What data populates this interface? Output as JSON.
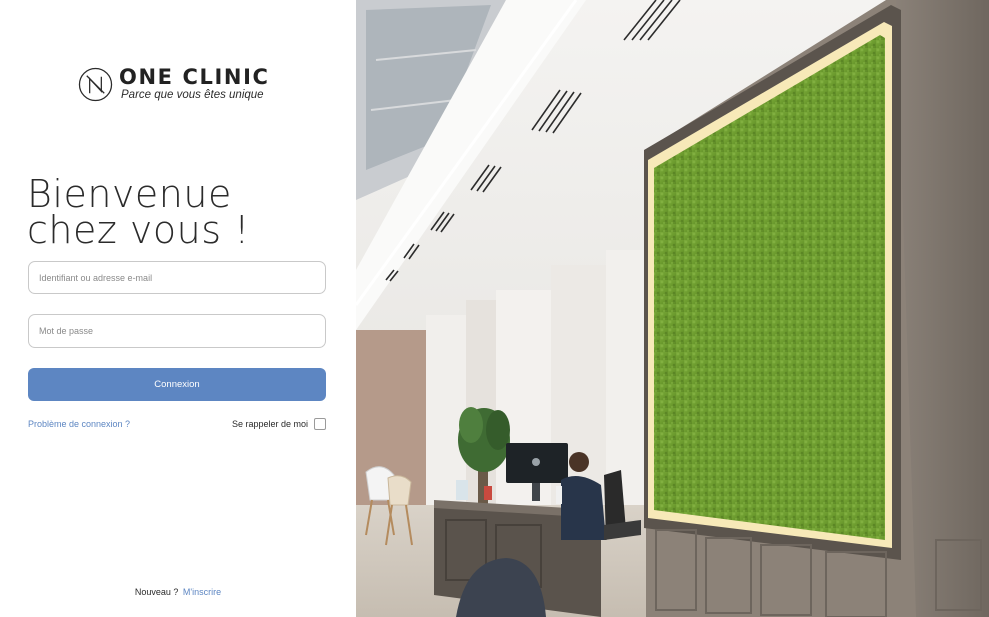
{
  "brand": {
    "name": "ONE CLINIC",
    "tagline": "Parce que vous êtes unique"
  },
  "welcome": {
    "line1": "Bienvenue",
    "line2": "chez vous !"
  },
  "form": {
    "login_placeholder": "Identifiant ou adresse e-mail",
    "password_placeholder": "Mot de passe",
    "submit_label": "Connexion",
    "forgot_label": "Problème de connexion ?",
    "remember_label": "Se rappeler de moi",
    "remember_checked": false
  },
  "signup": {
    "prompt": "Nouveau ?",
    "link_label": "M'inscrire"
  },
  "colors": {
    "accent": "#5d86c2",
    "text": "#2b2b2b",
    "border": "#c9c9c9",
    "moss": "#6b9a2e"
  },
  "icons": {
    "logo": "one-clinic-logo-icon",
    "checkbox": "checkbox-icon"
  }
}
